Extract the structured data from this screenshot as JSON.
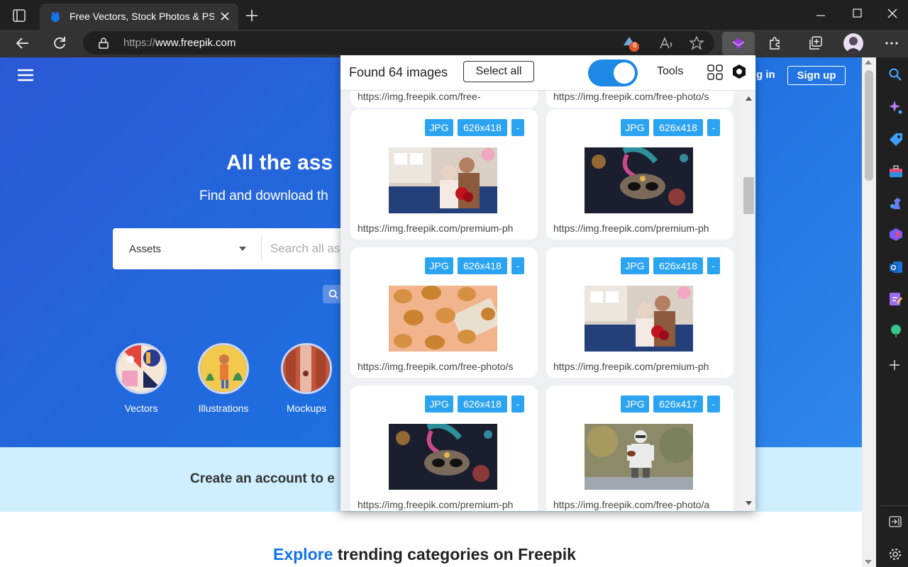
{
  "browser": {
    "tab_title": "Free Vectors, Stock Photos & PSD",
    "url_prefix": "https://",
    "url_domain": "www.freepik.com",
    "extension_badge_count": "6"
  },
  "page": {
    "login_label": "g in",
    "signup_label": "Sign up",
    "hero_title": "All the ass",
    "hero_subtitle": "Find and download th",
    "search_category": "Assets",
    "search_placeholder": "Search all as",
    "categories": [
      "Vectors",
      "Illustrations",
      "Mockups"
    ],
    "banner_text": "Create an account to e",
    "explore_highlight": "Explore",
    "explore_rest": " trending categories on Freepik"
  },
  "popup": {
    "found_text": "Found 64 images",
    "select_all_label": "Select all",
    "tools_label": "Tools",
    "toggle_on": true,
    "partial_top_urls": [
      "https://img.freepik.com/free-",
      "https://img.freepik.com/free-photo/s"
    ],
    "cards": [
      {
        "format": "JPG",
        "size": "626x418",
        "extra": "-",
        "image": "couple-valentine",
        "url": "https://img.freepik.com/premium-ph"
      },
      {
        "format": "JPG",
        "size": "626x418",
        "extra": "-",
        "image": "carnival-mask",
        "url": "https://img.freepik.com/premium-ph"
      },
      {
        "format": "JPG",
        "size": "626x418",
        "extra": "-",
        "image": "fried-nuggets",
        "url": "https://img.freepik.com/free-photo/s"
      },
      {
        "format": "JPG",
        "size": "626x418",
        "extra": "-",
        "image": "couple-valentine",
        "url": "https://img.freepik.com/premium-ph"
      },
      {
        "format": "JPG",
        "size": "626x418",
        "extra": "-",
        "image": "carnival-mask",
        "url": "https://img.freepik.com/premium-ph"
      },
      {
        "format": "JPG",
        "size": "626x417",
        "extra": "-",
        "image": "football-player",
        "url": "https://img.freepik.com/free-photo/a"
      }
    ]
  },
  "colors": {
    "brand_blue": "#1273eb",
    "badge": "#2aa3f0",
    "toggle": "#1e88e5"
  }
}
